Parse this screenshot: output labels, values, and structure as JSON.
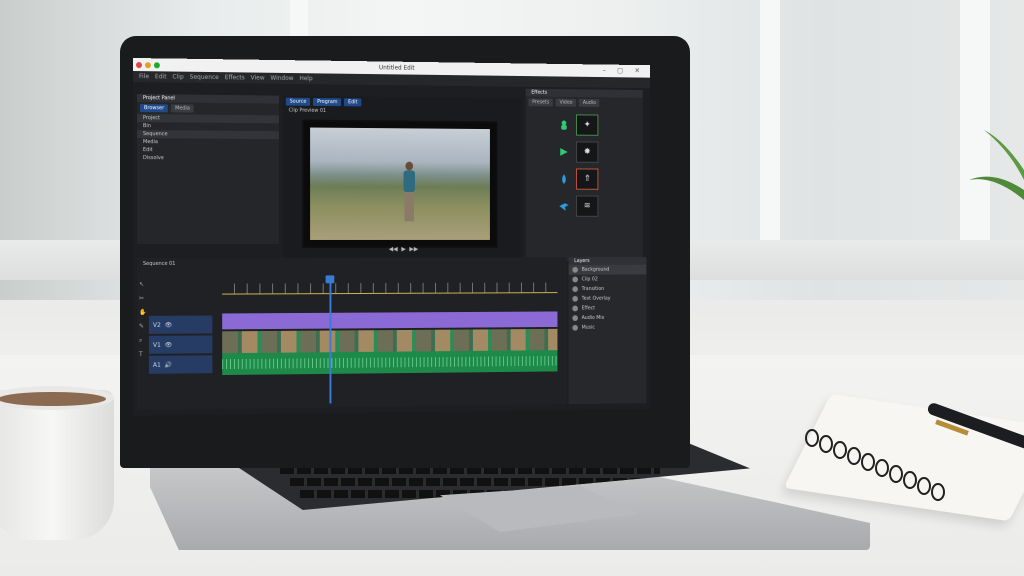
{
  "window": {
    "title": "Untitled Edit",
    "menu": [
      "File",
      "Edit",
      "Clip",
      "Sequence",
      "Effects",
      "View",
      "Window",
      "Help"
    ]
  },
  "project_panel": {
    "header": "Project Panel",
    "tabs": [
      "Browser",
      "Media"
    ],
    "items": [
      "Project",
      "Bin",
      "Sequence",
      "Media",
      "Edit",
      "Dissolve"
    ]
  },
  "preview_panel": {
    "tabs": [
      "Source",
      "Program",
      "Edit"
    ],
    "subtitle": "Clip Preview 01"
  },
  "effects_panel": {
    "header": "Effects",
    "tabs": [
      "Presets",
      "Video",
      "Audio"
    ],
    "items": [
      {
        "icon": "person-icon",
        "thumb": "figure",
        "state": "selected"
      },
      {
        "icon": "play-icon",
        "thumb": "sparkle",
        "state": "normal"
      },
      {
        "icon": "drop-icon",
        "thumb": "arrow-up",
        "state": "selected-alt"
      },
      {
        "icon": "bird-icon",
        "thumb": "wave",
        "state": "normal"
      }
    ]
  },
  "timeline": {
    "sequence_label": "Sequence 01",
    "tracks": [
      "V2",
      "V1",
      "A1"
    ]
  },
  "layers_panel": {
    "header": "Layers",
    "items": [
      "Background",
      "Clip 02",
      "Transition",
      "Text Overlay",
      "Effect",
      "Audio Mix",
      "Music"
    ]
  },
  "colors": {
    "accent": "#3a7bd5",
    "clip_purple": "#8c6ad6",
    "clip_green": "#1d8a4a",
    "effect_green": "#2ecc71",
    "effect_blue": "#2e9bdb"
  }
}
